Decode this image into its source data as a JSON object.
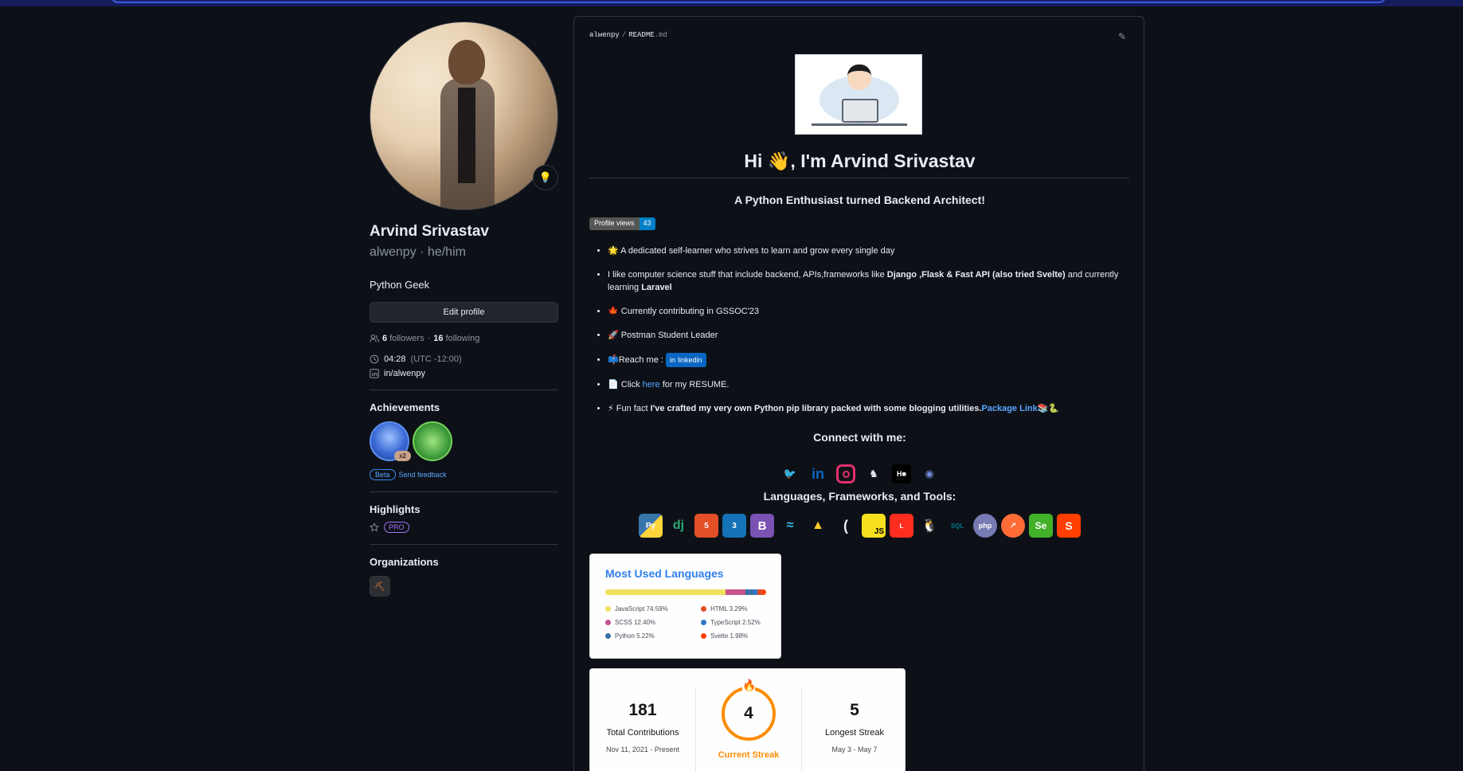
{
  "profile": {
    "name": "Arvind Srivastav",
    "login": "alwenpy",
    "pronouns": "he/him",
    "login_line": "alwenpy · he/him",
    "bio": "Python Geek",
    "edit_button": "Edit profile",
    "followers_count": "6",
    "followers_label": "followers",
    "following_count": "16",
    "following_label": "following",
    "local_time": "04:28",
    "timezone": "(UTC -12:00)",
    "linkedin": "in/alwenpy",
    "status_icon": "lightbulb-icon"
  },
  "achievements": {
    "title": "Achievements",
    "badge_multiplier": "x2",
    "beta_label": "Beta",
    "feedback_label": "Send feedback"
  },
  "highlights": {
    "title": "Highlights",
    "pro_label": "PRO"
  },
  "organizations": {
    "title": "Organizations"
  },
  "readme": {
    "path_owner": "alwenpy",
    "path_sep": "/",
    "path_file": "README",
    "path_ext": ".md",
    "title": "Hi 👋, I'm Arvind Srivastav",
    "subtitle": "A Python Enthusiast turned Backend Architect!",
    "views_label": "Profile views",
    "views_count": "43",
    "bullets": {
      "b1": "🌟 A dedicated self-learner who strives to learn and grow every single day",
      "b2_pre": "I like computer science stuff that include backend, APIs,frameworks like ",
      "b2_bold": "Django ,Flask & Fast API (also tried Svelte)",
      "b2_mid": " and currently learning ",
      "b2_bold2": "Laravel",
      "b3": "🍁 Currently contributing in GSSOC'23",
      "b4": "🚀 Postman Student Leader",
      "b5_pre": "📫Reach me : ",
      "b5_badge": "linkedin",
      "b6_pre": "📄 Click ",
      "b6_link": "here",
      "b6_post": " for my RESUME.",
      "b7_pre": "⚡ Fun fact ",
      "b7_bold": "I've crafted my very own Python pip library packed with some blogging utilities.",
      "b7_link": "Package Link",
      "b7_emoji": "📚🐍"
    },
    "connect_title": "Connect with me:",
    "tools_title": "Languages, Frameworks, and Tools:"
  },
  "languages_card": {
    "title": "Most Used Languages",
    "items": [
      {
        "name": "JavaScript",
        "percent": "74.59%",
        "value": 74.59,
        "color": "#f1e05a"
      },
      {
        "name": "HTML",
        "percent": "3.29%",
        "value": 3.29,
        "color": "#e34c26"
      },
      {
        "name": "SCSS",
        "percent": "12.40%",
        "value": 12.4,
        "color": "#c6538c"
      },
      {
        "name": "TypeScript",
        "percent": "2.52%",
        "value": 2.52,
        "color": "#3178c6"
      },
      {
        "name": "Python",
        "percent": "5.22%",
        "value": 5.22,
        "color": "#3572A5"
      },
      {
        "name": "Svelte",
        "percent": "1.98%",
        "value": 1.98,
        "color": "#ff3e00"
      }
    ]
  },
  "streak_card": {
    "total": "181",
    "total_label": "Total Contributions",
    "total_range": "Nov 11, 2021 - Present",
    "current": "4",
    "current_label": "Current Streak",
    "longest": "5",
    "longest_label": "Longest Streak",
    "longest_range": "May 3 - May 7",
    "accent": "#fb8c00"
  },
  "colors": {
    "bg": "#0d1117",
    "border": "#30363d",
    "text": "#e6edf3",
    "muted": "#8b949e",
    "link": "#58a6ff"
  }
}
